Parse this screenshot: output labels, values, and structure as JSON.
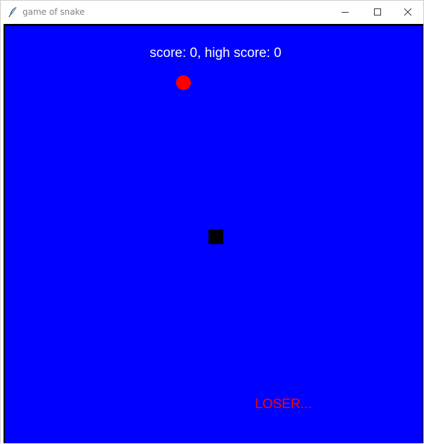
{
  "window": {
    "title": "game of snake",
    "icon": "feather-icon",
    "controls": [
      "minimize-icon",
      "maximize-icon",
      "close-icon"
    ]
  },
  "game": {
    "score_text": "score: 0, high score: 0",
    "score": 0,
    "high_score": 0,
    "status_text": "LOSER...",
    "colors": {
      "background": "#0000ff",
      "food": "#ff0000",
      "snake": "#000000",
      "score_text": "#ffffff",
      "status_text": "#ff0000"
    }
  }
}
